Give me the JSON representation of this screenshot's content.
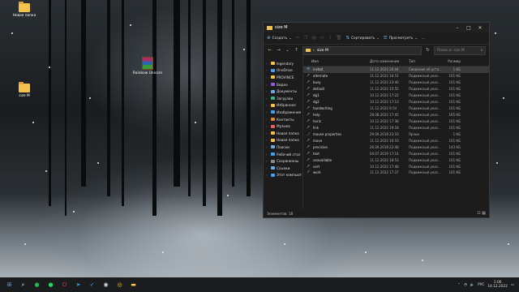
{
  "desktop": {
    "icons": [
      {
        "label": "Новая папка",
        "kind": "folder-icon"
      },
      {
        "label": "Rainbow Unicorn",
        "kind": "winrar-icon"
      },
      {
        "label": "size M",
        "kind": "folder-icon"
      }
    ]
  },
  "explorer": {
    "title": "size M",
    "toolbar": {
      "create": "Создать",
      "sort": "Сортировать",
      "view": "Просмотреть",
      "more": "…"
    },
    "address": "size M",
    "search_placeholder": "Поиск в: size M",
    "columns": {
      "name": "Имя",
      "date": "Дата изменения",
      "type": "Тип",
      "size": "Размер"
    },
    "nav": [
      {
        "label": "legendary",
        "icon": "folder-icon",
        "color": "#f2c14e"
      },
      {
        "label": "OneDrive",
        "icon": "cloud-icon",
        "color": "#4a9ee8"
      },
      {
        "label": "PROVINCE",
        "icon": "folder-icon",
        "color": "#f2c14e"
      },
      {
        "label": "Видео",
        "icon": "video-icon",
        "color": "#8a5cd6"
      },
      {
        "label": "Документы",
        "icon": "documents-icon",
        "color": "#6fa8dc"
      },
      {
        "label": "Загрузки",
        "icon": "download-icon",
        "color": "#3fb37f"
      },
      {
        "label": "Избранное",
        "icon": "star-icon",
        "color": "#f2c14e"
      },
      {
        "label": "Изображения",
        "icon": "pictures-icon",
        "color": "#4a9ee8"
      },
      {
        "label": "Контакты",
        "icon": "contacts-icon",
        "color": "#d98c3a"
      },
      {
        "label": "Музыка",
        "icon": "music-icon",
        "color": "#e06666"
      },
      {
        "label": "Новая папка",
        "icon": "folder-icon",
        "color": "#f2c14e"
      },
      {
        "label": "Новая папка",
        "icon": "folder-icon",
        "color": "#f2c14e"
      },
      {
        "label": "Поиски",
        "icon": "search-icon",
        "color": "#6fa8dc"
      },
      {
        "label": "Рабочий стол",
        "icon": "desktop-icon",
        "color": "#4a9ee8"
      },
      {
        "label": "Сохраненны",
        "icon": "games-icon",
        "color": "#8a8a8a"
      },
      {
        "label": "Ссылки",
        "icon": "links-icon",
        "color": "#6fa8dc"
      },
      {
        "label": "Этот компьют",
        "icon": "computer-icon",
        "color": "#4a9ee8"
      }
    ],
    "files": [
      {
        "name": "install",
        "date": "11.12.2022 20:04",
        "type": "Сведения об уста...",
        "size": "1 КБ",
        "icon": "settings-file-icon"
      },
      {
        "name": "alternate",
        "date": "11.12.2022 16:51",
        "type": "Подвижный указ...",
        "size": "101 КБ",
        "icon": "cursor-icon"
      },
      {
        "name": "busy",
        "date": "11.12.2022 23:40",
        "type": "Подвижный указ...",
        "size": "101 КБ",
        "icon": "cursor-icon"
      },
      {
        "name": "default",
        "date": "11.12.2022 15:55",
        "type": "Подвижный указ...",
        "size": "101 КБ",
        "icon": "cursor-icon"
      },
      {
        "name": "dg1",
        "date": "10.12.2022 17:22",
        "type": "Подвижный указ...",
        "size": "101 КБ",
        "icon": "cursor-icon"
      },
      {
        "name": "dg2",
        "date": "10.12.2022 17:13",
        "type": "Подвижный указ...",
        "size": "101 КБ",
        "icon": "cursor-icon"
      },
      {
        "name": "handwriting",
        "date": "11.12.2022 9:54",
        "type": "Подвижный указ...",
        "size": "101 КБ",
        "icon": "cursor-icon"
      },
      {
        "name": "help",
        "date": "28.08.2022 17:45",
        "type": "Подвижный указ...",
        "size": "165 КБ",
        "icon": "cursor-icon"
      },
      {
        "name": "horiz",
        "date": "10.12.2022 17:38",
        "type": "Подвижный указ...",
        "size": "101 КБ",
        "icon": "cursor-icon"
      },
      {
        "name": "link",
        "date": "11.12.2022 19:18",
        "type": "Подвижный указ...",
        "size": "101 КБ",
        "icon": "cursor-icon"
      },
      {
        "name": "mouse properties",
        "date": "29.09.2018 23:10",
        "type": "Ярлык",
        "size": "1 КБ",
        "icon": "shortcut-icon"
      },
      {
        "name": "move",
        "date": "11.12.2022 16:10",
        "type": "Подвижный указ...",
        "size": "101 КБ",
        "icon": "cursor-icon"
      },
      {
        "name": "precision",
        "date": "26.09.2018 22:48",
        "type": "Подвижный указ...",
        "size": "143 КБ",
        "icon": "cursor-icon"
      },
      {
        "name": "text",
        "date": "04.07.2019 17:14",
        "type": "Подвижный указ...",
        "size": "101 КБ",
        "icon": "cursor-icon"
      },
      {
        "name": "unavailable",
        "date": "11.12.2022 18:53",
        "type": "Подвижный указ...",
        "size": "101 КБ",
        "icon": "cursor-icon"
      },
      {
        "name": "vert",
        "date": "10.12.2022 17:48",
        "type": "Подвижный указ...",
        "size": "101 КБ",
        "icon": "cursor-icon"
      },
      {
        "name": "work",
        "date": "11.12.2022 17:37",
        "type": "Подвижный указ...",
        "size": "101 КБ",
        "icon": "cursor-icon"
      }
    ],
    "status": "Элементов: 18",
    "selected_index": 0
  },
  "taskbar": {
    "apps": [
      {
        "name": "start-icon",
        "glyph": "⊞",
        "color": "#4aa3ff"
      },
      {
        "name": "search-icon",
        "glyph": "⌕",
        "color": "#dddddd"
      },
      {
        "name": "spotify-icon",
        "glyph": "●",
        "color": "#1db954"
      },
      {
        "name": "whatsapp-icon",
        "glyph": "●",
        "color": "#25d366"
      },
      {
        "name": "opera-icon",
        "glyph": "O",
        "color": "#e0293b"
      },
      {
        "name": "telegram-icon",
        "glyph": "➤",
        "color": "#2aa3e0"
      },
      {
        "name": "checkmark-app-icon",
        "glyph": "✓",
        "color": "#5aa0e0"
      },
      {
        "name": "steam-icon",
        "glyph": "◉",
        "color": "#cfd8e0"
      },
      {
        "name": "chrome-icon",
        "glyph": "◎",
        "color": "#f4c20d"
      },
      {
        "name": "file-explorer-icon",
        "glyph": "▬",
        "color": "#f2c14e"
      }
    ],
    "language": "РУС",
    "time": "1:06",
    "date": "14.12.2022"
  }
}
